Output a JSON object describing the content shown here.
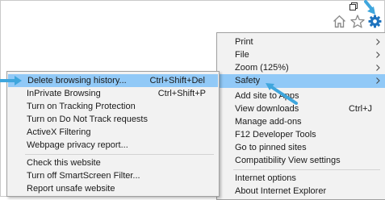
{
  "colors": {
    "menu_bg": "#f2f2f2",
    "highlight": "#91c9f7",
    "callout_arrow": "#3fa6dd",
    "icon_gray": "#8a8a8a",
    "gear_blue": "#1e73be"
  },
  "toolbar": {
    "icons": [
      "home-icon",
      "favorites-star-icon",
      "tools-gear-icon"
    ]
  },
  "main_menu": {
    "items": [
      {
        "label": "Print",
        "shortcut": "",
        "submenu": true
      },
      {
        "label": "File",
        "shortcut": "",
        "submenu": true
      },
      {
        "label": "Zoom (125%)",
        "shortcut": "",
        "submenu": true
      },
      {
        "label": "Safety",
        "shortcut": "",
        "submenu": true,
        "highlighted": true
      },
      {
        "label": "Add site to Apps",
        "shortcut": "",
        "submenu": false
      },
      {
        "label": "View downloads",
        "shortcut": "Ctrl+J",
        "submenu": false
      },
      {
        "label": "Manage add-ons",
        "shortcut": "",
        "submenu": false
      },
      {
        "label": "F12 Developer Tools",
        "shortcut": "",
        "submenu": false
      },
      {
        "label": "Go to pinned sites",
        "shortcut": "",
        "submenu": false
      },
      {
        "label": "Compatibility View settings",
        "shortcut": "",
        "submenu": false
      },
      {
        "label": "Internet options",
        "shortcut": "",
        "submenu": false
      },
      {
        "label": "About Internet Explorer",
        "shortcut": "",
        "submenu": false
      }
    ]
  },
  "safety_submenu": {
    "items": [
      {
        "label": "Delete browsing history...",
        "shortcut": "Ctrl+Shift+Del",
        "highlighted": true
      },
      {
        "label": "InPrivate Browsing",
        "shortcut": "Ctrl+Shift+P"
      },
      {
        "label": "Turn on Tracking Protection",
        "shortcut": ""
      },
      {
        "label": "Turn on Do Not Track requests",
        "shortcut": ""
      },
      {
        "label": "ActiveX Filtering",
        "shortcut": ""
      },
      {
        "label": "Webpage privacy report...",
        "shortcut": ""
      },
      {
        "label": "Check this website",
        "shortcut": ""
      },
      {
        "label": "Turn off SmartScreen Filter...",
        "shortcut": ""
      },
      {
        "label": "Report unsafe website",
        "shortcut": ""
      }
    ]
  }
}
